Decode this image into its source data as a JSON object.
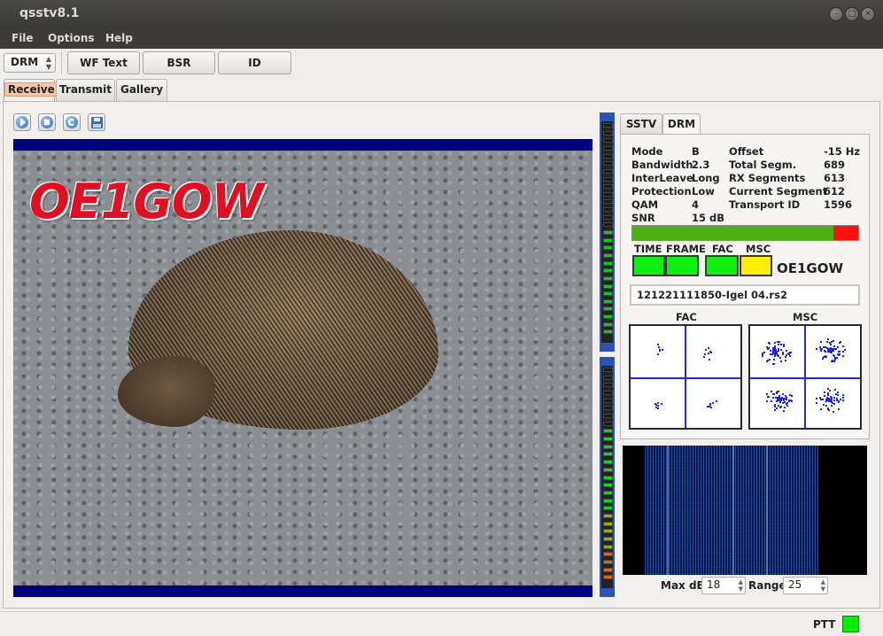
{
  "window": {
    "title": "qsstv8.1"
  },
  "menu": {
    "items": [
      "File",
      "Options",
      "Help"
    ]
  },
  "toolbar": {
    "mode_value": "DRM",
    "buttons": [
      "WF Text",
      "BSR",
      "ID"
    ]
  },
  "tabs": [
    "Receive",
    "Transmit",
    "Gallery"
  ],
  "receive_icons": [
    "start-icon",
    "stop-icon",
    "refresh-icon",
    "save-icon"
  ],
  "image": {
    "overlay_text": "OE1GOW"
  },
  "right_tabs": [
    "SSTV",
    "DRM"
  ],
  "drm": {
    "left": [
      {
        "k": "Mode",
        "v": "B"
      },
      {
        "k": "Bandwidth",
        "v": "2.3"
      },
      {
        "k": "InterLeave",
        "v": "Long"
      },
      {
        "k": "Protection",
        "v": "Low"
      },
      {
        "k": "QAM",
        "v": "4"
      },
      {
        "k": "SNR",
        "v": "15 dB"
      }
    ],
    "right": [
      {
        "k": "Offset",
        "v": "-15 Hz"
      },
      {
        "k": "Total Segm.",
        "v": "689"
      },
      {
        "k": "RX  Segments",
        "v": "613"
      },
      {
        "k": "Current Segment",
        "v": "612"
      },
      {
        "k": "Transport ID",
        "v": "1596"
      }
    ],
    "signal_level": 0.89,
    "leds": [
      {
        "label": "TIME",
        "color": "#11ee11"
      },
      {
        "label": "FRAME",
        "color": "#11ee11"
      },
      {
        "label": "FAC",
        "color": "#11ee11"
      },
      {
        "label": "MSC",
        "color": "#ffee00"
      }
    ],
    "callsign": "OE1GOW",
    "filename": "121221111850-Igel 04.rs2",
    "fac_label": "FAC",
    "msc_label": "MSC"
  },
  "waterfall": {
    "maxdb_label": "Max dB",
    "maxdb_value": "18",
    "range_label": "Range",
    "range_value": "25"
  },
  "status": {
    "ptt_label": "PTT",
    "ptt_color": "#00ee00"
  }
}
